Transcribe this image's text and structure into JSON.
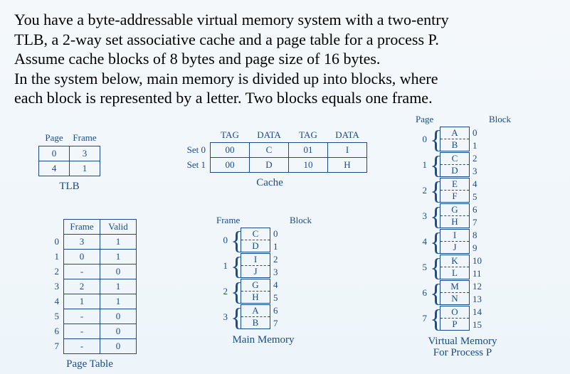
{
  "description": {
    "l1": "You have a byte-addressable virtual memory system with a two-entry",
    "l2": "TLB, a 2-way set associative cache and a page table for a process P.",
    "l3": "Assume cache blocks of 8 bytes and page size of 16 bytes.",
    "l4": "In the system below, main memory is divided up into blocks, where",
    "l5": "each block is represented by a letter. Two blocks equals one frame."
  },
  "tlb": {
    "title": "TLB",
    "headers": [
      "Page",
      "Frame"
    ],
    "rows": [
      {
        "page": "0",
        "frame": "3"
      },
      {
        "page": "4",
        "frame": "1"
      }
    ]
  },
  "cache": {
    "title": "Cache",
    "headers": [
      "TAG",
      "DATA",
      "TAG",
      "DATA"
    ],
    "sets": [
      {
        "label": "Set 0",
        "tag0": "00",
        "data0": "C",
        "tag1": "01",
        "data1": "I"
      },
      {
        "label": "Set 1",
        "tag0": "00",
        "data0": "D",
        "tag1": "10",
        "data1": "H"
      }
    ]
  },
  "page_table": {
    "title": "Page Table",
    "headers": [
      "Frame",
      "Valid"
    ],
    "rows": [
      {
        "idx": "0",
        "frame": "3",
        "valid": "1"
      },
      {
        "idx": "1",
        "frame": "0",
        "valid": "1"
      },
      {
        "idx": "2",
        "frame": "-",
        "valid": "0"
      },
      {
        "idx": "3",
        "frame": "2",
        "valid": "1"
      },
      {
        "idx": "4",
        "frame": "1",
        "valid": "1"
      },
      {
        "idx": "5",
        "frame": "-",
        "valid": "0"
      },
      {
        "idx": "6",
        "frame": "-",
        "valid": "0"
      },
      {
        "idx": "7",
        "frame": "-",
        "valid": "0"
      }
    ]
  },
  "main_memory": {
    "title": "Main Memory",
    "frame_header": "Frame",
    "block_header": "Block",
    "frames": [
      {
        "idx": "0",
        "b0": "C",
        "b1": "D",
        "bi0": "0",
        "bi1": "1"
      },
      {
        "idx": "1",
        "b0": "I",
        "b1": "J",
        "bi0": "2",
        "bi1": "3"
      },
      {
        "idx": "2",
        "b0": "G",
        "b1": "H",
        "bi0": "4",
        "bi1": "5"
      },
      {
        "idx": "3",
        "b0": "A",
        "b1": "B",
        "bi0": "6",
        "bi1": "7"
      }
    ]
  },
  "virtual_memory": {
    "title1": "Virtual Memory",
    "title2": "For Process P",
    "page_header": "Page",
    "block_header": "Block",
    "pages": [
      {
        "idx": "0",
        "b0": "A",
        "b1": "B",
        "bi0": "0",
        "bi1": "1"
      },
      {
        "idx": "1",
        "b0": "C",
        "b1": "D",
        "bi0": "2",
        "bi1": "3"
      },
      {
        "idx": "2",
        "b0": "E",
        "b1": "F",
        "bi0": "4",
        "bi1": "5"
      },
      {
        "idx": "3",
        "b0": "G",
        "b1": "H",
        "bi0": "6",
        "bi1": "7"
      },
      {
        "idx": "4",
        "b0": "I",
        "b1": "J",
        "bi0": "8",
        "bi1": "9"
      },
      {
        "idx": "5",
        "b0": "K",
        "b1": "L",
        "bi0": "10",
        "bi1": "11"
      },
      {
        "idx": "6",
        "b0": "M",
        "b1": "N",
        "bi0": "12",
        "bi1": "13"
      },
      {
        "idx": "7",
        "b0": "O",
        "b1": "P",
        "bi0": "14",
        "bi1": "15"
      }
    ]
  },
  "chart_data": {
    "type": "table",
    "tlb": [
      [
        0,
        3
      ],
      [
        4,
        1
      ]
    ],
    "cache_sets": [
      {
        "set": 0,
        "way0": {
          "tag": "00",
          "data": "C"
        },
        "way1": {
          "tag": "01",
          "data": "I"
        }
      },
      {
        "set": 1,
        "way0": {
          "tag": "00",
          "data": "D"
        },
        "way1": {
          "tag": "10",
          "data": "H"
        }
      }
    ],
    "page_table": [
      {
        "page": 0,
        "frame": 3,
        "valid": 1
      },
      {
        "page": 1,
        "frame": 0,
        "valid": 1
      },
      {
        "page": 2,
        "frame": null,
        "valid": 0
      },
      {
        "page": 3,
        "frame": 2,
        "valid": 1
      },
      {
        "page": 4,
        "frame": 1,
        "valid": 1
      },
      {
        "page": 5,
        "frame": null,
        "valid": 0
      },
      {
        "page": 6,
        "frame": null,
        "valid": 0
      },
      {
        "page": 7,
        "frame": null,
        "valid": 0
      }
    ],
    "main_memory_frames": [
      [
        "C",
        "D"
      ],
      [
        "I",
        "J"
      ],
      [
        "G",
        "H"
      ],
      [
        "A",
        "B"
      ]
    ],
    "virtual_memory_pages": [
      [
        "A",
        "B"
      ],
      [
        "C",
        "D"
      ],
      [
        "E",
        "F"
      ],
      [
        "G",
        "H"
      ],
      [
        "I",
        "J"
      ],
      [
        "K",
        "L"
      ],
      [
        "M",
        "N"
      ],
      [
        "O",
        "P"
      ]
    ]
  }
}
